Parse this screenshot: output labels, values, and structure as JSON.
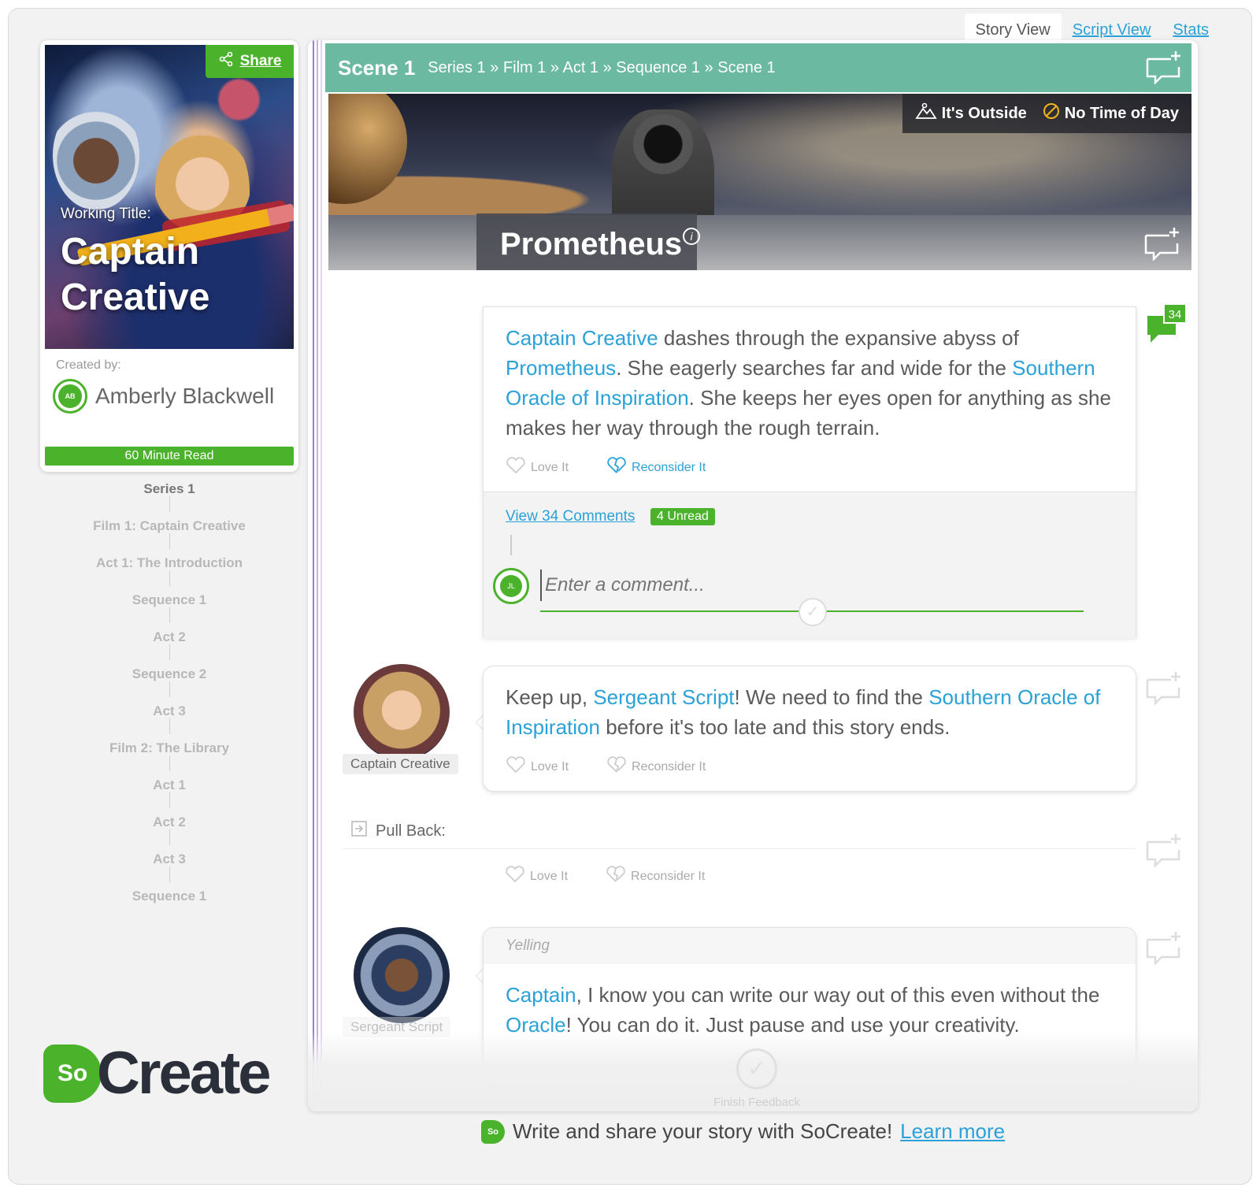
{
  "view_tabs": [
    {
      "label": "Story View",
      "active": true
    },
    {
      "label": "Script View",
      "active": false
    },
    {
      "label": "Stats",
      "active": false
    }
  ],
  "story": {
    "share_label": "Share",
    "working_title_label": "Working Title:",
    "title_line1": "Captain",
    "title_line2": "Creative",
    "created_by_label": "Created by:",
    "author_name": "Amberly Blackwell",
    "author_initials": "AB",
    "read_time": "60 Minute Read"
  },
  "outline": [
    "Series 1",
    "Film 1: Captain Creative",
    "Act 1: The Introduction",
    "Sequence 1",
    "Act 2",
    "Sequence 2",
    "Act 3",
    "Film 2: The Library",
    "Act 1",
    "Act 2",
    "Act 3",
    "Sequence 1"
  ],
  "logo": {
    "badge": "So",
    "text": "Create"
  },
  "scene": {
    "number": "Scene 1",
    "breadcrumb": "Series 1 » Film 1 » Act 1 » Sequence 1 » Scene 1",
    "location_type": "It's Outside",
    "time_of_day": "No Time of Day",
    "location_name": "Prometheus",
    "info_glyph": "i"
  },
  "action_card": {
    "segments": [
      {
        "text": "Captain Creative",
        "hl": true
      },
      {
        "text": " dashes through the expansive abyss of ",
        "hl": false
      },
      {
        "text": "Prometheus",
        "hl": true
      },
      {
        "text": ". She eagerly searches far and wide for the ",
        "hl": false
      },
      {
        "text": "Southern Oracle of Inspiration",
        "hl": true
      },
      {
        "text": ". She keeps her eyes open for anything as she makes her way through the rough terrain.",
        "hl": false
      }
    ],
    "love_label": "Love It",
    "reconsider_label": "Reconsider It",
    "comment_count_badge": "34",
    "view_comments_label": "View 34 Comments",
    "unread_label": "4 Unread",
    "commenter_initials": "JL",
    "comment_placeholder": "Enter a comment..."
  },
  "dialogue1": {
    "character": "Captain Creative",
    "segments": [
      {
        "text": "Keep up, ",
        "hl": false
      },
      {
        "text": "Sergeant Script",
        "hl": true
      },
      {
        "text": "! We need to find the ",
        "hl": false
      },
      {
        "text": "Southern Oracle of Inspiration",
        "hl": true
      },
      {
        "text": " before it's too late and this story ends.",
        "hl": false
      }
    ],
    "love_label": "Love It",
    "reconsider_label": "Reconsider It"
  },
  "transition": {
    "label": "Pull Back:",
    "love_label": "Love It",
    "reconsider_label": "Reconsider It"
  },
  "dialogue2": {
    "character": "Sergeant Script",
    "parenthetical": "Yelling",
    "segments": [
      {
        "text": "Captain",
        "hl": true
      },
      {
        "text": ", I know you can write our way out of this even without the ",
        "hl": false
      },
      {
        "text": "Oracle",
        "hl": true
      },
      {
        "text": "! You can do it. Just pause and use your creativity.",
        "hl": false
      }
    ]
  },
  "finish_label": "Finish Feedback",
  "footer": {
    "text": "Write and share your story with SoCreate!",
    "link": "Learn more",
    "badge": "So"
  },
  "colors": {
    "brand_green": "#4bb32b",
    "scene_teal": "#6ab9a0",
    "link_blue": "#2aa1d8"
  }
}
